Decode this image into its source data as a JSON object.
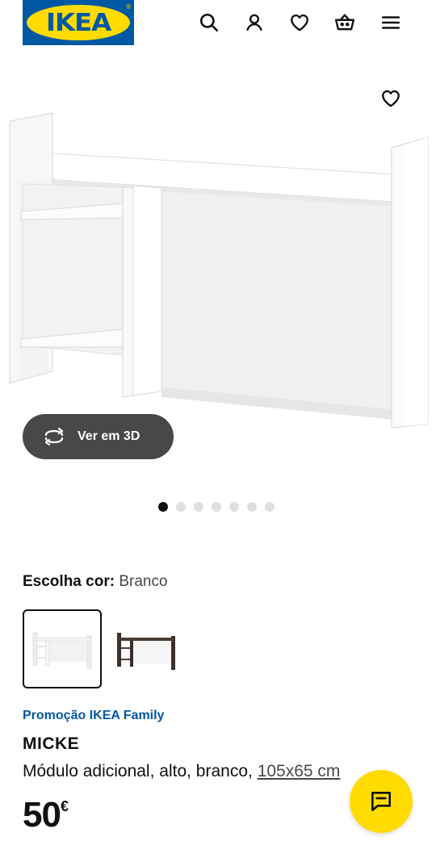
{
  "header": {
    "logo_text": "IKEA",
    "logo_mark": "®",
    "icons": [
      "search-icon",
      "account-icon",
      "wishlist-icon",
      "cart-icon",
      "menu-icon"
    ]
  },
  "gallery": {
    "view_3d_label": "Ver em 3D",
    "image_count": 7,
    "active_index": 0
  },
  "color": {
    "label": "Escolha cor:",
    "value": "Branco",
    "options": [
      "white",
      "dark-brown"
    ]
  },
  "product": {
    "promo": "Promoção IKEA Family",
    "name": "MICKE",
    "description": "Módulo adicional, alto, branco, ",
    "measure": "105x65 cm",
    "price": "50",
    "currency": "€"
  },
  "colors": {
    "ikea_blue": "#0058a3",
    "ikea_yellow": "#ffdb00",
    "dark_button": "#484848"
  }
}
